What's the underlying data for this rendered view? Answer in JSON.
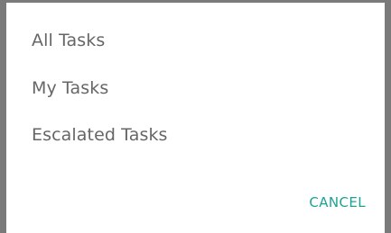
{
  "dialog": {
    "options": [
      {
        "label": "All Tasks"
      },
      {
        "label": "My Tasks"
      },
      {
        "label": "Escalated Tasks"
      }
    ],
    "cancel_label": "CANCEL"
  },
  "colors": {
    "option_text": "#666666",
    "accent": "#1ba391",
    "scrim": "#7a7a7a"
  }
}
